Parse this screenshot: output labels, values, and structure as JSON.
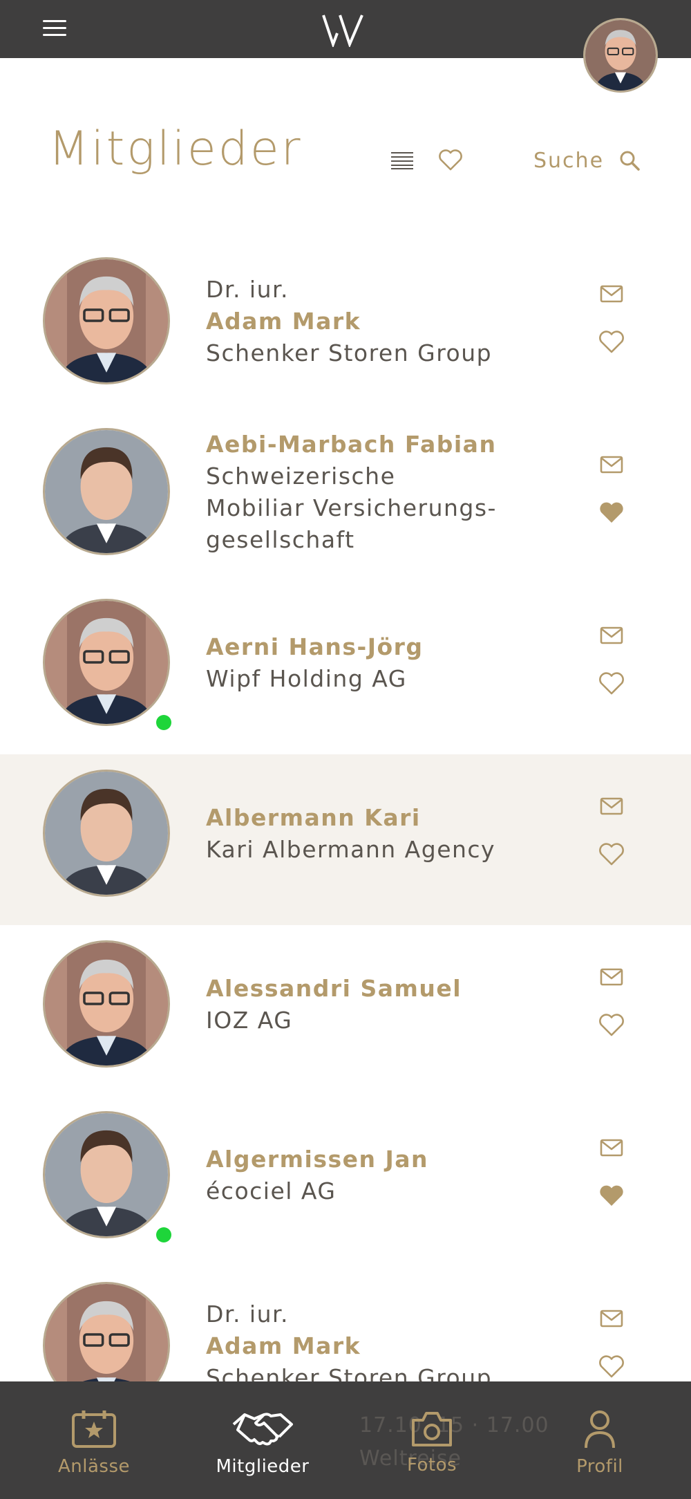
{
  "header": {
    "title": "Mitglieder",
    "search_label": "Suche"
  },
  "members": [
    {
      "title": "Dr. iur.",
      "name": "Adam Mark",
      "company": [
        "Schenker Storen Group"
      ],
      "favorite": false,
      "online": false,
      "highlight": false,
      "photo": "grey-haired-man-glasses"
    },
    {
      "title": "",
      "name": "Aebi-Marbach Fabian",
      "company": [
        "Schweizerische",
        "Mobiliar Versicherungs-",
        "gesellschaft"
      ],
      "favorite": true,
      "online": false,
      "highlight": false,
      "photo": "young-man-dark-hair"
    },
    {
      "title": "",
      "name": "Aerni Hans-Jörg",
      "company": [
        "Wipf Holding AG"
      ],
      "favorite": false,
      "online": true,
      "highlight": false,
      "photo": "grey-haired-man-glasses"
    },
    {
      "title": "",
      "name": "Albermann Kari",
      "company": [
        "Kari Albermann Agency"
      ],
      "favorite": false,
      "online": false,
      "highlight": true,
      "photo": "young-man-dark-hair"
    },
    {
      "title": "",
      "name": "Alessandri Samuel",
      "company": [
        "IOZ AG"
      ],
      "favorite": false,
      "online": false,
      "highlight": false,
      "photo": "grey-haired-man-glasses"
    },
    {
      "title": "",
      "name": "Algermissen Jan",
      "company": [
        "écociel AG"
      ],
      "favorite": true,
      "online": true,
      "highlight": false,
      "photo": "young-man-dark-hair"
    },
    {
      "title": "Dr. iur.",
      "name": "Adam Mark",
      "company": [
        "Schenker Storen Group"
      ],
      "favorite": false,
      "online": false,
      "highlight": false,
      "photo": "grey-haired-man-glasses"
    }
  ],
  "nav": {
    "items": [
      {
        "label": "Anlässe",
        "icon": "calendar-star-icon",
        "active": false
      },
      {
        "label": "Mitglieder",
        "icon": "handshake-icon",
        "active": true
      },
      {
        "label": "Fotos",
        "icon": "camera-icon",
        "active": false
      },
      {
        "label": "Profil",
        "icon": "person-icon",
        "active": false
      }
    ],
    "ghost_text": [
      "17.10. 15 · 17.00",
      "Weltreise"
    ]
  },
  "colors": {
    "bar": "#3f3e3e",
    "gold": "#b39a6b",
    "text": "#5a554f",
    "highlight_row": "#f5f2ed",
    "online": "#1ed53a"
  }
}
